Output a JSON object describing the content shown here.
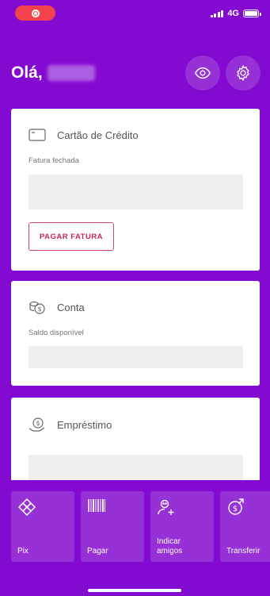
{
  "status_bar": {
    "network": "4G"
  },
  "header": {
    "greeting": "Olá,"
  },
  "credit_card": {
    "title": "Cartão de Crédito",
    "subtitle": "Fatura fechada",
    "pay_button": "PAGAR FATURA"
  },
  "account": {
    "title": "Conta",
    "subtitle": "Saldo disponível"
  },
  "loan": {
    "title": "Empréstimo"
  },
  "shortcuts": [
    {
      "label": "Pix",
      "icon": "pix-icon"
    },
    {
      "label": "Pagar",
      "icon": "barcode-icon"
    },
    {
      "label": "Indicar\namigos",
      "icon": "add-friend-icon"
    },
    {
      "label": "Transferir",
      "icon": "transfer-icon"
    }
  ],
  "colors": {
    "brand": "#820ad1",
    "pay_button": "#c2265f",
    "record": "#f2424b"
  }
}
